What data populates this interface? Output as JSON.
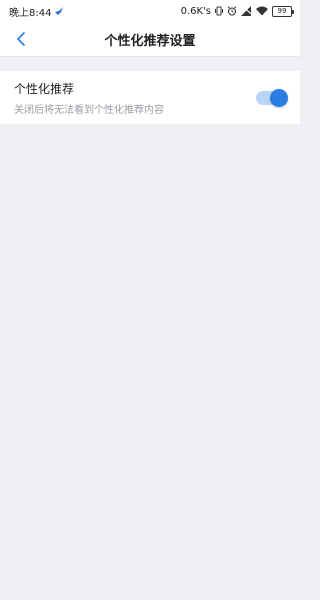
{
  "status_bar": {
    "time": "晚上8:44",
    "network_speed": "0.6K's",
    "battery_level": "99"
  },
  "nav": {
    "title": "个性化推荐设置"
  },
  "settings": {
    "items": [
      {
        "title": "个性化推荐",
        "subtitle": "关闭后将无法看到个性化推荐内容",
        "toggle_on": true
      }
    ]
  },
  "colors": {
    "accent": "#2a7de1",
    "toggle_track": "#b9d4f5",
    "background": "#eef0f4"
  }
}
